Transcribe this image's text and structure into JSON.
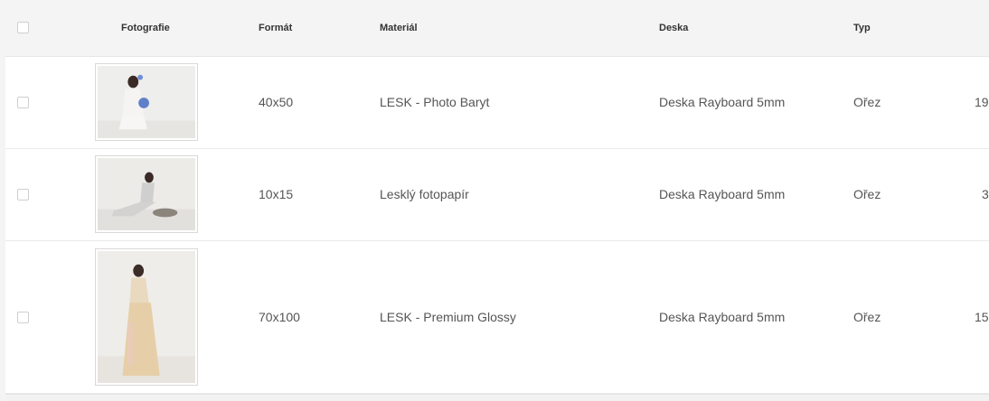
{
  "table": {
    "columns": {
      "photo": "Fotografie",
      "format": "Formát",
      "material": "Materiál",
      "board": "Deska",
      "type": "Typ"
    },
    "rows": [
      {
        "photo_icon": "photo-thumbnail-woman-sitting-with-flowers",
        "format": "40x50",
        "material": "LESK - Photo Baryt",
        "board": "Deska Rayboard 5mm",
        "type": "Ořez",
        "extra": "19"
      },
      {
        "photo_icon": "photo-thumbnail-woman-reclining",
        "format": "10x15",
        "material": "Lesklý fotopapír",
        "board": "Deska Rayboard 5mm",
        "type": "Ořez",
        "extra": "3"
      },
      {
        "photo_icon": "photo-thumbnail-woman-standing-in-dress",
        "format": "70x100",
        "material": "LESK - Premium Glossy",
        "board": "Deska Rayboard 5mm",
        "type": "Ořez",
        "extra": "15"
      }
    ]
  }
}
